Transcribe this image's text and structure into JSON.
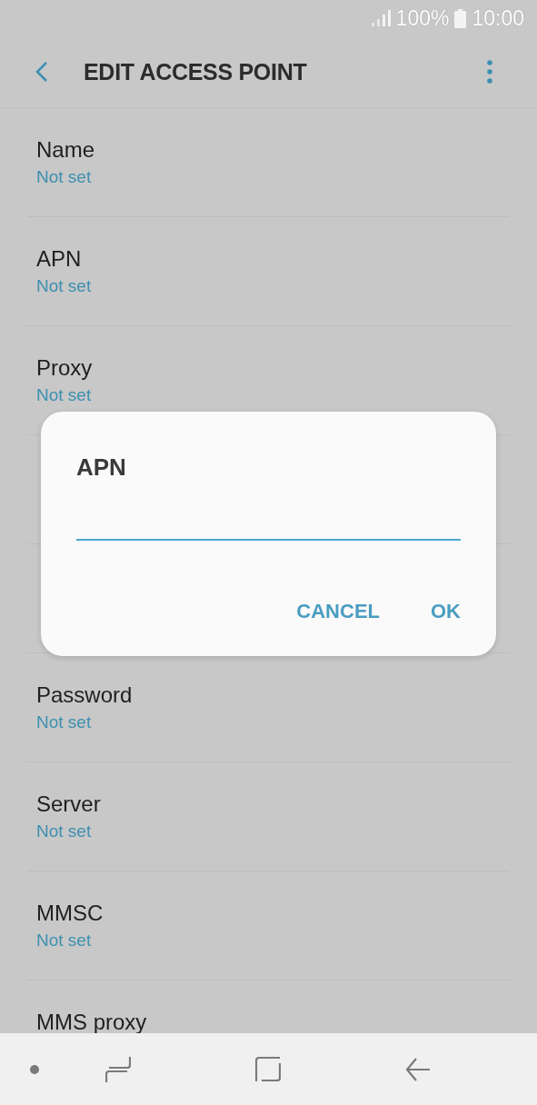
{
  "status_bar": {
    "battery": "100%",
    "time": "10:00"
  },
  "header": {
    "title": "EDIT ACCESS POINT"
  },
  "fields": [
    {
      "label": "Name",
      "value": "Not set"
    },
    {
      "label": "APN",
      "value": "Not set"
    },
    {
      "label": "Proxy",
      "value": "Not set"
    },
    {
      "covered": true
    },
    {
      "covered": true
    },
    {
      "label": "Password",
      "value": "Not set"
    },
    {
      "label": "Server",
      "value": "Not set"
    },
    {
      "label": "MMSC",
      "value": "Not set"
    },
    {
      "label": "MMS proxy"
    }
  ],
  "dialog": {
    "title": "APN",
    "buttons": [
      "CANCEL",
      "OK"
    ]
  }
}
